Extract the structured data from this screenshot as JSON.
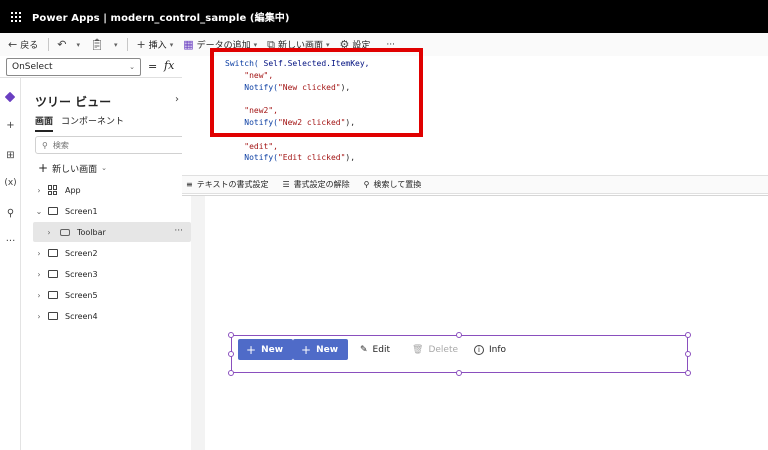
{
  "titlebar": {
    "title": "Power Apps  |  modern_control_sample (編集中)"
  },
  "command_bar": {
    "back_label": "戻る",
    "insert_label": "挿入",
    "add_data_label": "データの追加",
    "new_screen_label": "新しい画面",
    "settings_label": "設定",
    "more_label": "···"
  },
  "formula_bar": {
    "property": "OnSelect",
    "equals": "=",
    "fx": "fx",
    "code_lines": [
      [
        {
          "t": "Switch( ",
          "c": "fn"
        },
        {
          "t": "Self.Selected.ItemKey,",
          "c": "kw"
        }
      ],
      [
        {
          "t": "    \"new\",",
          "c": "str"
        }
      ],
      [
        {
          "t": "    ",
          "c": "plain"
        },
        {
          "t": "Notify(",
          "c": "fn"
        },
        {
          "t": "\"New clicked\"",
          "c": "str"
        },
        {
          "t": "),",
          "c": "plain"
        }
      ],
      [
        {
          "t": "",
          "c": "plain"
        }
      ],
      [
        {
          "t": "    \"new2\",",
          "c": "str"
        }
      ],
      [
        {
          "t": "    ",
          "c": "plain"
        },
        {
          "t": "Notify(",
          "c": "fn"
        },
        {
          "t": "\"New2 clicked\"",
          "c": "str"
        },
        {
          "t": "),",
          "c": "plain"
        }
      ],
      [
        {
          "t": "",
          "c": "plain"
        }
      ],
      [
        {
          "t": "    \"edit\",",
          "c": "str"
        }
      ],
      [
        {
          "t": "    ",
          "c": "plain"
        },
        {
          "t": "Notify(",
          "c": "fn"
        },
        {
          "t": "\"Edit clicked\"",
          "c": "str"
        },
        {
          "t": "),",
          "c": "plain"
        }
      ]
    ]
  },
  "format_bar": {
    "format_text": "テキストの書式設定",
    "remove_format": "書式設定の解除",
    "find_replace": "検索して置換"
  },
  "tree_view": {
    "title": "ツリー ビュー",
    "tab_screens": "画面",
    "tab_components": "コンポーネント",
    "search_placeholder": "検索",
    "new_screen": "新しい画面",
    "items": [
      {
        "label": "App",
        "kind": "app"
      },
      {
        "label": "Screen1",
        "kind": "screen",
        "expanded": true
      },
      {
        "label": "Toolbar",
        "kind": "toolbar",
        "selected": true
      },
      {
        "label": "Screen2",
        "kind": "screen"
      },
      {
        "label": "Screen3",
        "kind": "screen"
      },
      {
        "label": "Screen5",
        "kind": "screen"
      },
      {
        "label": "Screen4",
        "kind": "screen"
      }
    ]
  },
  "toolbar_control": {
    "new_label": "New",
    "new2_label": "New",
    "edit_label": "Edit",
    "delete_label": "Delete",
    "info_label": "Info"
  },
  "colors": {
    "accent": "#4f6bc8",
    "selection": "#8a4fbe",
    "highlight_box": "#e00000"
  }
}
